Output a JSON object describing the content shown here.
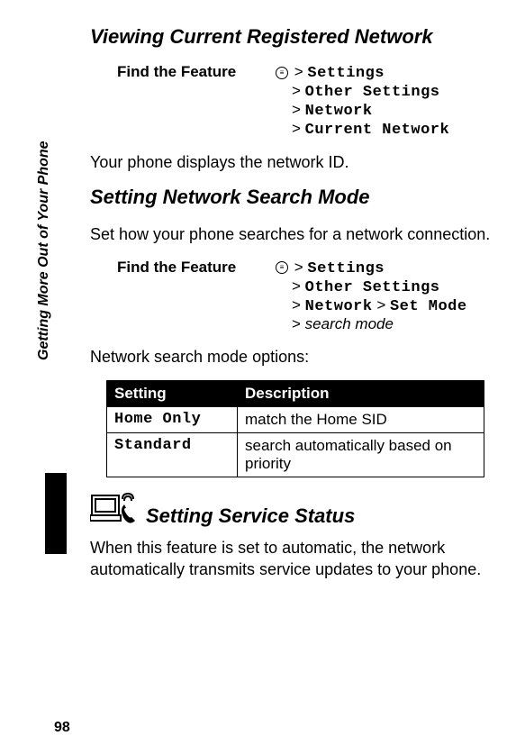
{
  "sidebar": "Getting More Out of Your Phone",
  "pageNumber": "98",
  "section1": {
    "heading": "Viewing Current Registered Network",
    "featureLabel": "Find the Feature",
    "menuIconGlyph": "≡",
    "path": {
      "l1": "Settings",
      "l2": "Other Settings",
      "l3": "Network",
      "l4": "Current Network"
    },
    "body": "Your phone displays the network ID."
  },
  "section2": {
    "heading": "Setting Network Search Mode",
    "intro": "Set how your phone searches for a network connection.",
    "featureLabel": "Find the Feature",
    "path": {
      "l1": "Settings",
      "l2": "Other Settings",
      "l3a": "Network",
      "l3b": "Set Mode",
      "l4": "search mode"
    },
    "optionsIntro": "Network search mode options:",
    "tableHeaders": {
      "c1": "Setting",
      "c2": "Description"
    },
    "rows": [
      {
        "setting": "Home Only",
        "desc": "match the Home SID"
      },
      {
        "setting": "Standard",
        "desc": "search automatically based on priority"
      }
    ]
  },
  "section3": {
    "heading": "Setting Service Status",
    "body": "When this feature is set to automatic, the network automatically transmits service updates to your phone."
  }
}
